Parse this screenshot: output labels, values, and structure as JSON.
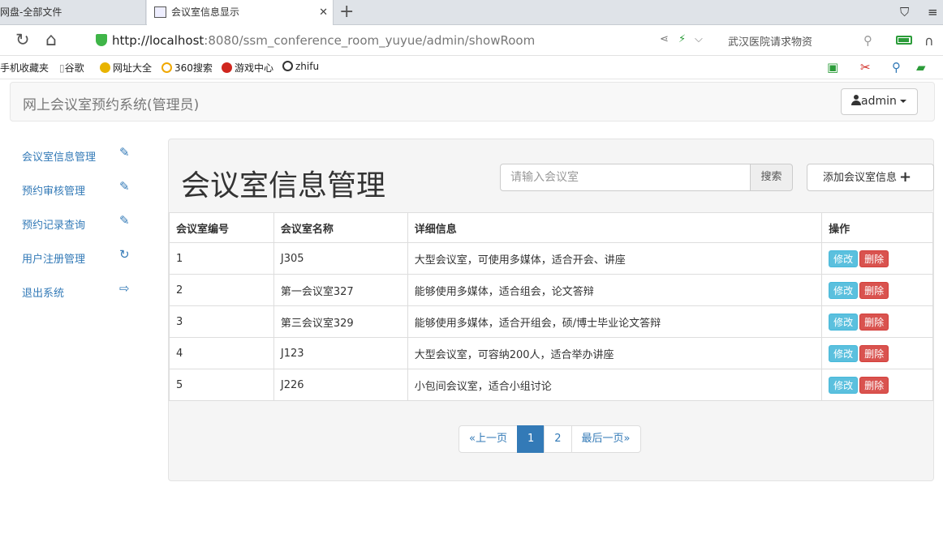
{
  "browser": {
    "tabs": [
      {
        "label": "网盘-全部文件"
      },
      {
        "label": "会议室信息显示"
      }
    ],
    "url_host": "http://localhost",
    "url_rest": ":8080/ssm_conference_room_yuyue/admin/showRoom",
    "address_hint": "武汉医院请求物资",
    "bookmarks": [
      "手机收藏夹",
      "谷歌",
      "网址大全",
      "360搜索",
      "游戏中心",
      "zhifu"
    ]
  },
  "app": {
    "brand": "网上会议室预约系统(管理员)",
    "user": "admin"
  },
  "sidebar": {
    "items": [
      {
        "label": "会议室信息管理",
        "icon": "pencil-icon"
      },
      {
        "label": "预约审核管理",
        "icon": "pencil-icon"
      },
      {
        "label": "预约记录查询",
        "icon": "pencil-icon"
      },
      {
        "label": "用户注册管理",
        "icon": "refresh-icon"
      },
      {
        "label": "退出系统",
        "icon": "logout-icon"
      }
    ]
  },
  "main": {
    "title": "会议室信息管理",
    "search_placeholder": "请输入会议室",
    "search_label": "搜索",
    "add_label": "添加会议室信息",
    "columns": [
      "会议室编号",
      "会议室名称",
      "详细信息",
      "操作"
    ],
    "rows": [
      {
        "id": "1",
        "name": "J305",
        "detail": "大型会议室，可使用多媒体，适合开会、讲座"
      },
      {
        "id": "2",
        "name": "第一会议室327",
        "detail": "能够使用多媒体，适合组会，论文答辩"
      },
      {
        "id": "3",
        "name": "第三会议室329",
        "detail": "能够使用多媒体，适合开组会，硕/博士毕业论文答辩"
      },
      {
        "id": "4",
        "name": "J123",
        "detail": "大型会议室，可容纳200人，适合举办讲座"
      },
      {
        "id": "5",
        "name": "J226",
        "detail": "小包间会议室，适合小组讨论"
      }
    ],
    "edit_label": "修改",
    "delete_label": "删除",
    "pagination": {
      "prev": "«上一页",
      "pages": [
        "1",
        "2"
      ],
      "active": "1",
      "last": "最后一页»"
    }
  }
}
